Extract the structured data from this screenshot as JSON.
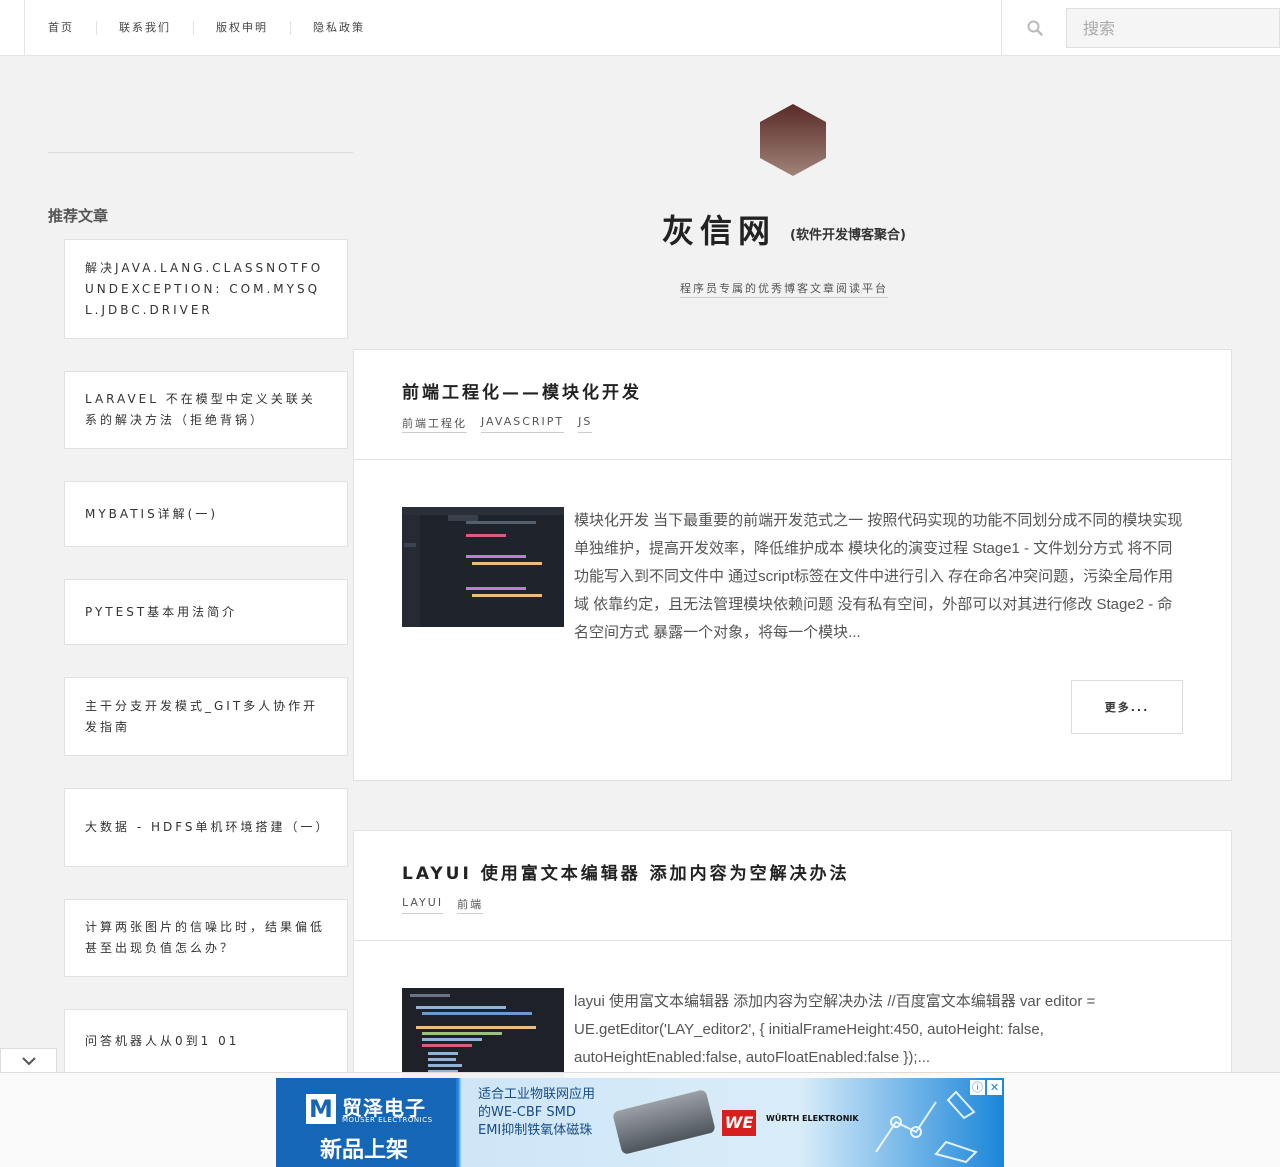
{
  "nav": {
    "items": [
      "首页",
      "联系我们",
      "版权申明",
      "隐私政策"
    ],
    "search_placeholder": "搜索"
  },
  "sidebar": {
    "title": "推荐文章",
    "items": [
      "解决JAVA.LANG.CLASSNOTFOUNDEXCEPTION: COM.MYSQL.JDBC.DRIVER",
      "LARAVEL 不在模型中定义关联关系的解决方法（拒绝背锅）",
      "MYBATIS详解(一)",
      "PYTEST基本用法简介",
      "主干分支开发模式_GIT多人协作开发指南",
      "大数据 - HDFS单机环境搭建（一）",
      "计算两张图片的信噪比时，结果偏低甚至出现负值怎么办？",
      "问答机器人从0到1 01"
    ]
  },
  "header": {
    "title": "灰信网",
    "subtitle": "(软件开发博客聚合)",
    "description": "程序员专属的优秀博客文章阅读平台"
  },
  "posts": [
    {
      "title": "前端工程化——模块化开发",
      "tags": [
        "前端工程化",
        "JAVASCRIPT",
        "JS"
      ],
      "excerpt": "模块化开发 当下最重要的前端开发范式之一 按照代码实现的功能不同划分成不同的模块实现单独维护，提高开发效率，降低维护成本 模块化的演变过程 Stage1 - 文件划分方式 将不同功能写入到不同文件中 通过script标签在文件中进行引入 存在命名冲突问题，污染全局作用域 依靠约定，且无法管理模块依赖问题 没有私有空间，外部可以对其进行修改 Stage2 - 命名空间方式 暴露一个对象，将每一个模块...",
      "more_label": "更多..."
    },
    {
      "title": "LAYUI 使用富文本编辑器 添加内容为空解决办法",
      "tags": [
        "LAYUI",
        "前端"
      ],
      "excerpt": "layui 使用富文本编辑器 添加内容为空解决办法 //百度富文本编辑器 var editor = UE.getEditor('LAY_editor2', { initialFrameHeight:450, autoHeight: false, autoHeightEnabled:false, autoFloatEnabled:false });..."
    }
  ],
  "ad": {
    "brand_mark": "M",
    "brand_name": "贸泽电子",
    "brand_en": "MOUSER ELECTRONICS",
    "headline": "新品上架",
    "copy": "适合工业物联网应用的WE-CBF SMD EMI抑制铁氧体磁珠",
    "partner_mark": "WE",
    "partner_name": "WÜRTH ELEKTRONIK",
    "info_icon": "ⓘ",
    "close_icon": "✕"
  },
  "colors": {
    "ad_blue": "#1566b6",
    "ad_red": "#d6201e"
  }
}
